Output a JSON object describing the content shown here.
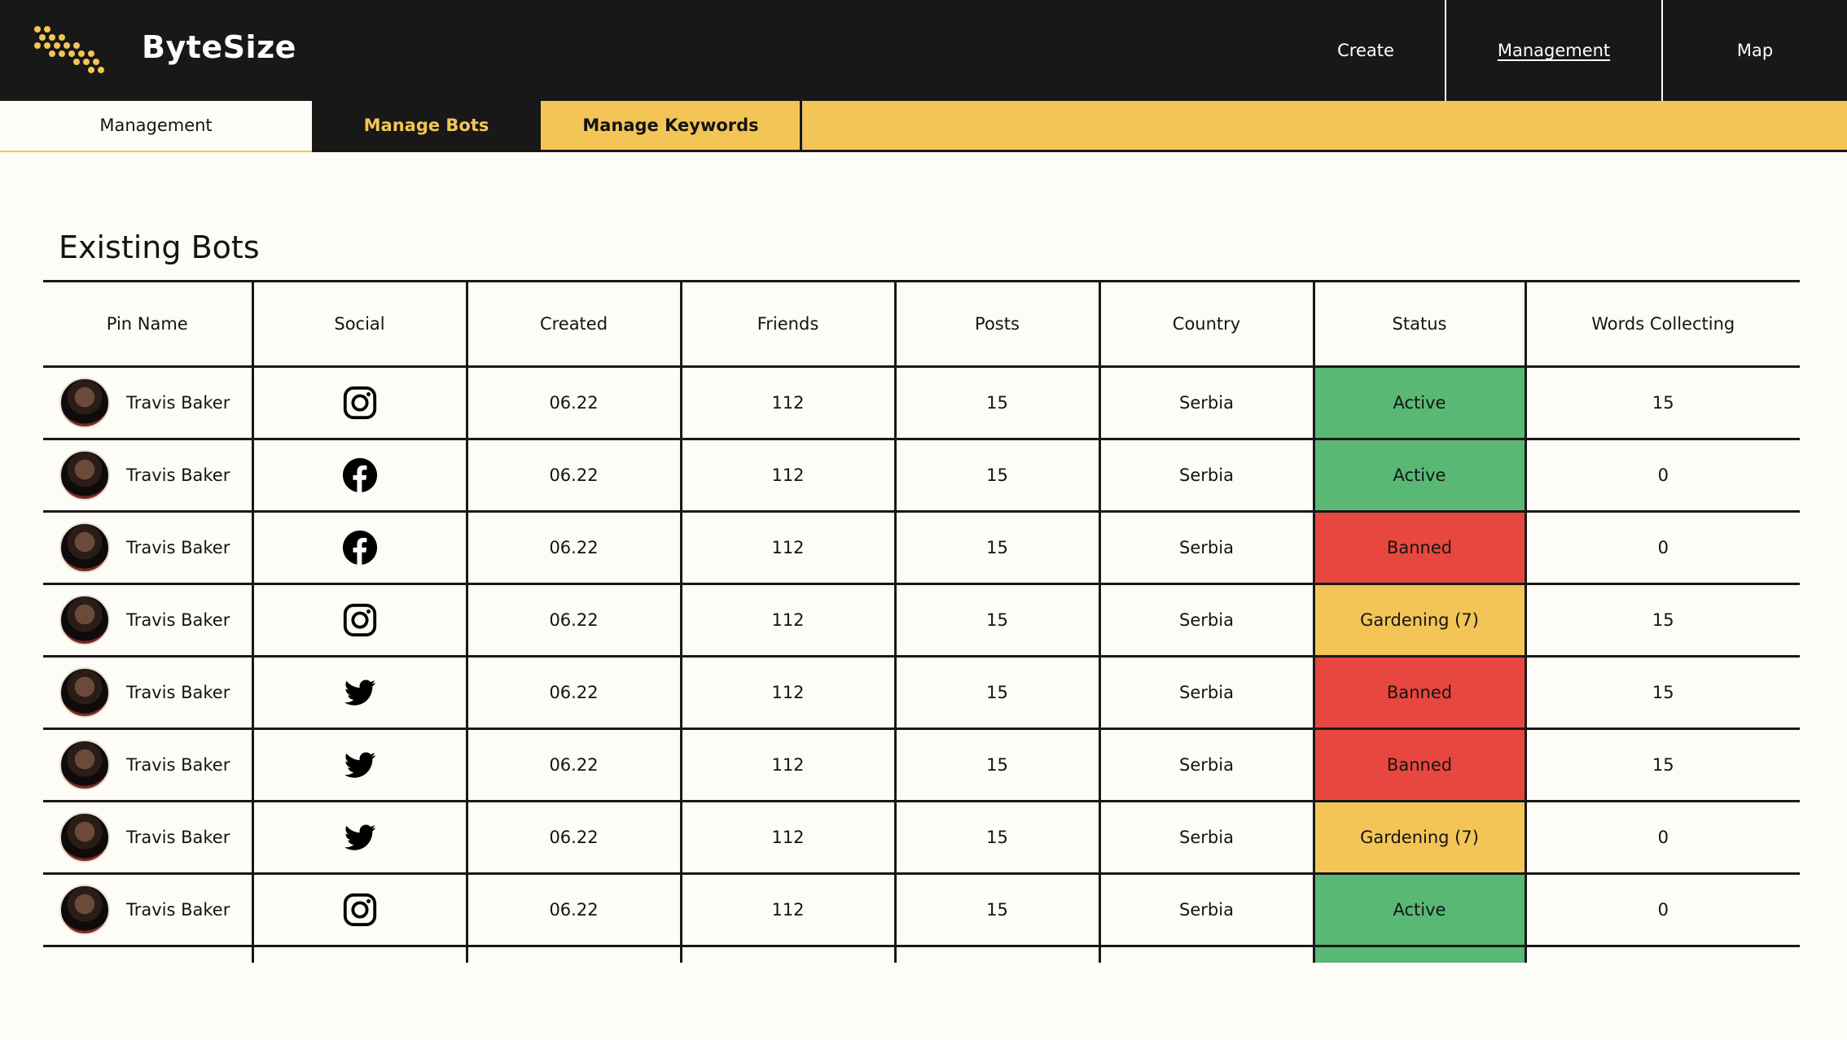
{
  "app": {
    "brand": "ByteSize"
  },
  "nav": {
    "create": "Create",
    "management": "Management",
    "map": "Map"
  },
  "subtabs": {
    "management": "Management",
    "manage_bots": "Manage Bots",
    "manage_keywords": "Manage Keywords"
  },
  "section": {
    "title": "Existing Bots"
  },
  "colors": {
    "active": "#59b874",
    "banned": "#e8473f",
    "gardening": "#f3c556",
    "accent": "#f3c556",
    "dark": "#181818"
  },
  "table": {
    "headers": [
      "Pin Name",
      "Social",
      "Created",
      "Friends",
      "Posts",
      "Country",
      "Status",
      "Words Collecting"
    ],
    "rows": [
      {
        "name": "Travis Baker",
        "social": "instagram-icon",
        "created": "06.22",
        "friends": "112",
        "posts": "15",
        "country": "Serbia",
        "status": "Active",
        "status_type": "active",
        "words": "15"
      },
      {
        "name": "Travis Baker",
        "social": "facebook-icon",
        "created": "06.22",
        "friends": "112",
        "posts": "15",
        "country": "Serbia",
        "status": "Active",
        "status_type": "active",
        "words": "0"
      },
      {
        "name": "Travis Baker",
        "social": "facebook-icon",
        "created": "06.22",
        "friends": "112",
        "posts": "15",
        "country": "Serbia",
        "status": "Banned",
        "status_type": "banned",
        "words": "0"
      },
      {
        "name": "Travis Baker",
        "social": "instagram-icon",
        "created": "06.22",
        "friends": "112",
        "posts": "15",
        "country": "Serbia",
        "status": "Gardening (7)",
        "status_type": "gardening",
        "words": "15"
      },
      {
        "name": "Travis Baker",
        "social": "twitter-icon",
        "created": "06.22",
        "friends": "112",
        "posts": "15",
        "country": "Serbia",
        "status": "Banned",
        "status_type": "banned",
        "words": "15"
      },
      {
        "name": "Travis Baker",
        "social": "twitter-icon",
        "created": "06.22",
        "friends": "112",
        "posts": "15",
        "country": "Serbia",
        "status": "Banned",
        "status_type": "banned",
        "words": "15"
      },
      {
        "name": "Travis Baker",
        "social": "twitter-icon",
        "created": "06.22",
        "friends": "112",
        "posts": "15",
        "country": "Serbia",
        "status": "Gardening (7)",
        "status_type": "gardening",
        "words": "0"
      },
      {
        "name": "Travis Baker",
        "social": "instagram-icon",
        "created": "06.22",
        "friends": "112",
        "posts": "15",
        "country": "Serbia",
        "status": "Active",
        "status_type": "active",
        "words": "0"
      },
      {
        "name": "",
        "social": "",
        "created": "",
        "friends": "",
        "posts": "",
        "country": "",
        "status": "",
        "status_type": "active",
        "words": ""
      }
    ]
  }
}
